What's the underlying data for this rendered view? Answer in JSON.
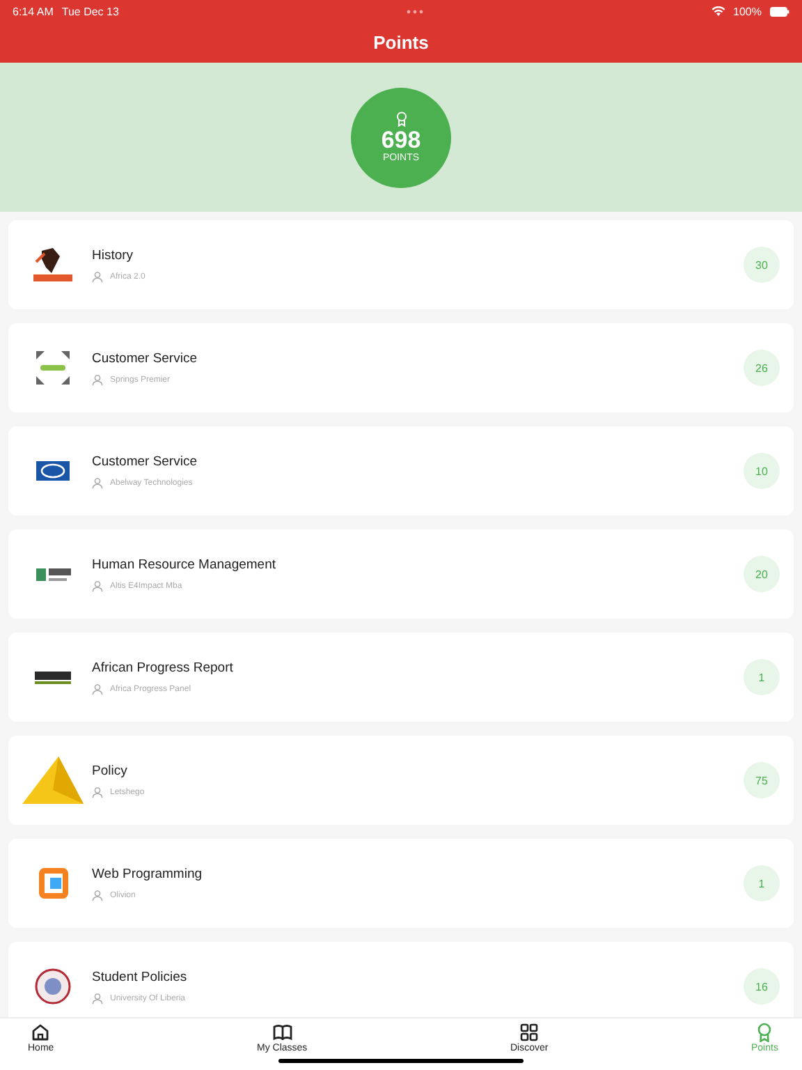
{
  "status_bar": {
    "time": "6:14 AM",
    "date": "Tue Dec 13",
    "battery": "100%"
  },
  "header": {
    "title": "Points"
  },
  "summary": {
    "total": "698",
    "unit": "POINTS"
  },
  "courses": [
    {
      "title": "History",
      "provider": "Africa 2.0",
      "points": "30",
      "kind": "africa2"
    },
    {
      "title": "Customer Service",
      "provider": "Springs Premier",
      "points": "26",
      "kind": "springs"
    },
    {
      "title": "Customer Service",
      "provider": "Abelway Technologies",
      "points": "10",
      "kind": "at"
    },
    {
      "title": "Human Resource Management",
      "provider": "Altis E4Impact Mba",
      "points": "20",
      "kind": "altis"
    },
    {
      "title": "African Progress Report",
      "provider": "Africa Progress Panel",
      "points": "1",
      "kind": "africa"
    },
    {
      "title": "Policy",
      "provider": "Letshego",
      "points": "75",
      "kind": "triangle"
    },
    {
      "title": "Web Programming",
      "provider": "Olivion",
      "points": "1",
      "kind": "square"
    },
    {
      "title": "Student Policies",
      "provider": "University Of Liberia",
      "points": "16",
      "kind": "seal"
    }
  ],
  "tabs": [
    {
      "label": "Home",
      "selected": false
    },
    {
      "label": "My Classes",
      "selected": false
    },
    {
      "label": "Discover",
      "selected": false
    },
    {
      "label": "Points",
      "selected": true
    }
  ]
}
